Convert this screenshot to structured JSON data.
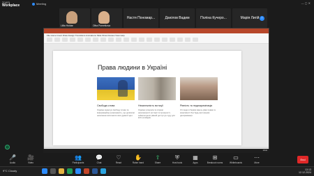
{
  "app": {
    "brand_top": "zoom",
    "brand_name": "Workplace",
    "meeting_label": "Meeting",
    "window_controls": "— ▢ ✕"
  },
  "participants": [
    {
      "name": "Liliia Holdar",
      "type": "camera",
      "color": "#c8a07c"
    },
    {
      "name": "Olha Pometkova",
      "type": "camera",
      "color": "#d9b08b"
    },
    {
      "name": "Настя Пономар...",
      "type": "text",
      "label": "Настя Пономар..."
    },
    {
      "name": "Данілов Вадим",
      "type": "text",
      "label": "Данілов Вадим"
    },
    {
      "name": "Поліна Кучеро...",
      "type": "text",
      "label": "Поліна Кучеро..."
    },
    {
      "name": "Марія Лигій",
      "type": "text",
      "label": "Марія Лигій"
    }
  ],
  "share": {
    "ribbon_tabs": "File  Home  Insert  Draw  Design  Transitions  Animations  Slide Show  Review  View  Help",
    "status": "Slide 1 of 6",
    "slide_title": "Права людини в Україні",
    "cards": [
      {
        "caption": "Свобода слова",
        "desc": "Україна гарантує свободу слова та інформаційну незалежність, що дозволяє незалежно висловити свої думки й ідеї."
      },
      {
        "caption": "Незалежність юстиції",
        "desc": "Україна утворила та сприяє незалежності юстиції та прозорості, забезпечуючи рівний доступ до суду для всіх громадян."
      },
      {
        "caption": "Рівність та недискримінація",
        "desc": "Усі люди в Україні мають рівні права та можливості без будь-якої форми дискримінації."
      }
    ],
    "tray": "18:02"
  },
  "toolbar": {
    "items": [
      {
        "label": "Audio",
        "icon": "🎤",
        "style": "red"
      },
      {
        "label": "Video",
        "icon": "🎥",
        "style": "red"
      },
      {
        "label": "Participants",
        "icon": "👥",
        "style": ""
      },
      {
        "label": "Chat",
        "icon": "💬",
        "style": ""
      },
      {
        "label": "React",
        "icon": "♡",
        "style": ""
      },
      {
        "label": "Raise hand",
        "icon": "✋",
        "style": ""
      },
      {
        "label": "Share",
        "icon": "⇧",
        "style": "green"
      },
      {
        "label": "Host tools",
        "icon": "⛨",
        "style": ""
      },
      {
        "label": "Apps",
        "icon": "▦",
        "style": ""
      },
      {
        "label": "Breakout rooms",
        "icon": "⊞",
        "style": ""
      },
      {
        "label": "Whiteboards",
        "icon": "▭",
        "style": ""
      },
      {
        "label": "More",
        "icon": "⋯",
        "style": ""
      }
    ],
    "end_label": "End"
  },
  "taskbar": {
    "weather": "9°C Cloudy",
    "clock": "13:13\n12.12.2024"
  }
}
